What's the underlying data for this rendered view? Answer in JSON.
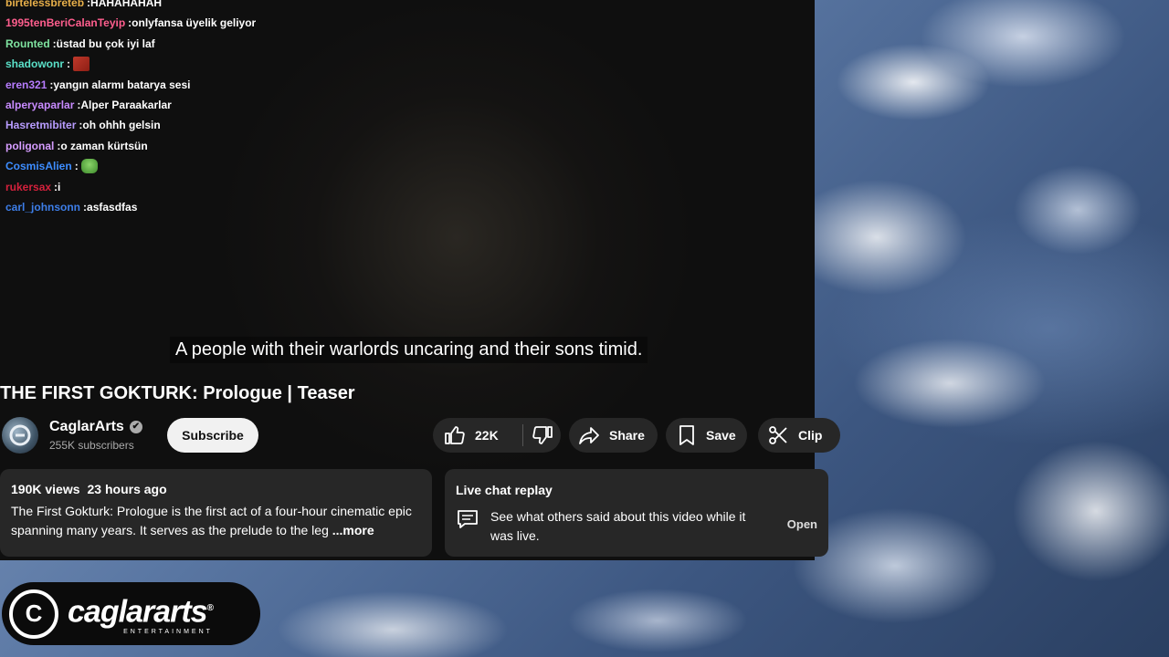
{
  "chat_messages": [
    {
      "user": "birtelessbreteb",
      "text": "HAHAHAHAH",
      "color": "#e8b04a",
      "emote": null
    },
    {
      "user": "1995tenBeriCalanTeyip",
      "text": "onlyfansa üyelik geliyor",
      "color": "#ff5e8e",
      "emote": null
    },
    {
      "user": "Rounted",
      "text": "üstad bu çok iyi laf",
      "color": "#7fe3a0",
      "emote": null
    },
    {
      "user": "shadowonr",
      "text": "",
      "color": "#5ae0c8",
      "emote": "red-emote"
    },
    {
      "user": "eren321",
      "text": "yangın alarmı batarya sesi",
      "color": "#b77cff",
      "emote": null
    },
    {
      "user": "alperyaparlar",
      "text": "Alper Paraakarlar",
      "color": "#c88bff",
      "emote": null
    },
    {
      "user": "Hasretmibiter",
      "text": "oh ohhh gelsin",
      "color": "#b89cff",
      "emote": null
    },
    {
      "user": "poligonal",
      "text": "o zaman kürtsün",
      "color": "#d59cff",
      "emote": null
    },
    {
      "user": "CosmisAlien",
      "text": "",
      "color": "#3d8dff",
      "emote": "green-emote"
    },
    {
      "user": "rukersax",
      "text": "i",
      "color": "#d4213c",
      "emote": null
    },
    {
      "user": "carl_johnsonn",
      "text": "asfasdfas",
      "color": "#3d7ee8",
      "emote": null
    }
  ],
  "subtitle": "A people with their warlords uncaring and their sons timid.",
  "video": {
    "title": "THE FIRST GOKTURK: Prologue | Teaser"
  },
  "channel": {
    "name": "CaglarArts",
    "subscribers": "255K subscribers",
    "verified_icon": "✔"
  },
  "actions": {
    "subscribe": "Subscribe",
    "like_count": "22K",
    "share": "Share",
    "save": "Save",
    "clip": "Clip"
  },
  "description": {
    "views": "190K views",
    "age": "23 hours ago",
    "text": "The First Gokturk: Prologue is the first act of a four-hour cinematic epic spanning many years. It serves as the prelude to the leg",
    "more": "...more"
  },
  "live_chat": {
    "title": "Live chat replay",
    "text": "See what others said about this video while it was live.",
    "open": "Open"
  },
  "logo": {
    "mark": "C",
    "text": "caglararts",
    "registered": "®",
    "subtext": "ENTERTAINMENT"
  }
}
